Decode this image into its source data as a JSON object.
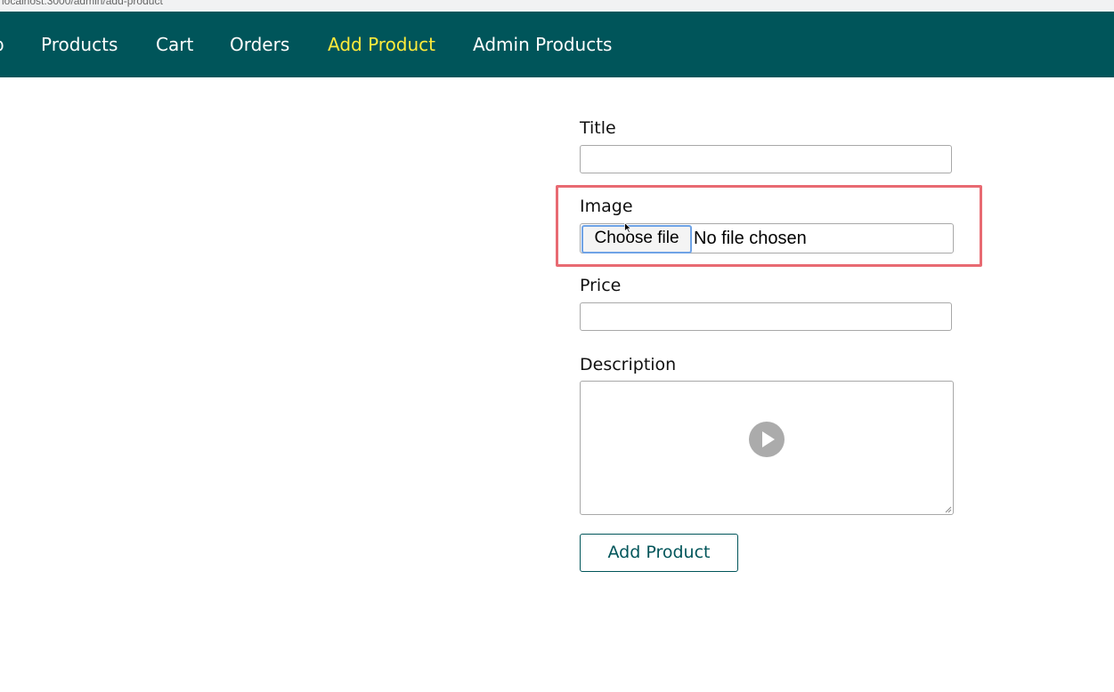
{
  "browser": {
    "url": "localhost:3000/admin/add-product"
  },
  "nav": {
    "edge_fragment": "p",
    "items": [
      {
        "label": "Products"
      },
      {
        "label": "Cart"
      },
      {
        "label": "Orders"
      },
      {
        "label": "Add Product",
        "active": true
      },
      {
        "label": "Admin Products"
      }
    ],
    "background_color": "#00555a",
    "active_color": "#ffeb3b"
  },
  "form": {
    "title_label": "Title",
    "title_value": "",
    "image_label": "Image",
    "image_button_label": "Choose file",
    "image_status": "No file chosen",
    "price_label": "Price",
    "price_value": "",
    "description_label": "Description",
    "description_value": "",
    "submit_label": "Add Product",
    "highlight_color": "#e86a72"
  },
  "overlay": {
    "play_icon": "play-icon",
    "cursor_icon": "cursor-arrow-icon"
  }
}
